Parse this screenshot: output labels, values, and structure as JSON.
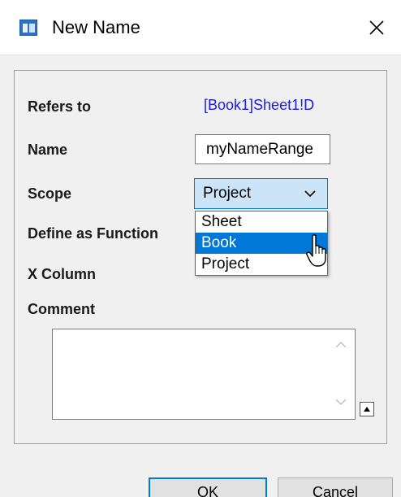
{
  "window": {
    "title": "New Name",
    "close_glyph": "✕"
  },
  "form": {
    "refers_to": {
      "label": "Refers to",
      "value": "[Book1]Sheet1!D"
    },
    "name": {
      "label": "Name",
      "value": "myNameRange"
    },
    "scope": {
      "label": "Scope",
      "value": "Project",
      "options": [
        "Sheet",
        "Book",
        "Project"
      ],
      "highlighted": "Book"
    },
    "define_as_function": {
      "label": "Define as Function"
    },
    "x_column": {
      "label": "X Column"
    },
    "comment": {
      "label": "Comment",
      "value": ""
    }
  },
  "buttons": {
    "ok": "OK",
    "cancel": "Cancel"
  },
  "colors": {
    "accent": "#0078d7",
    "link": "#1a1ae6",
    "combo_bg": "#cce4f7"
  },
  "icons": {
    "app": "window-app-icon",
    "close": "close-icon",
    "combo_arrow": "chevron-down-icon",
    "cursor": "mouse-pointer-icon",
    "scroll_up": "scroll-up-icon",
    "scroll_down": "scroll-down-icon",
    "expand": "expand-triangle-icon"
  }
}
